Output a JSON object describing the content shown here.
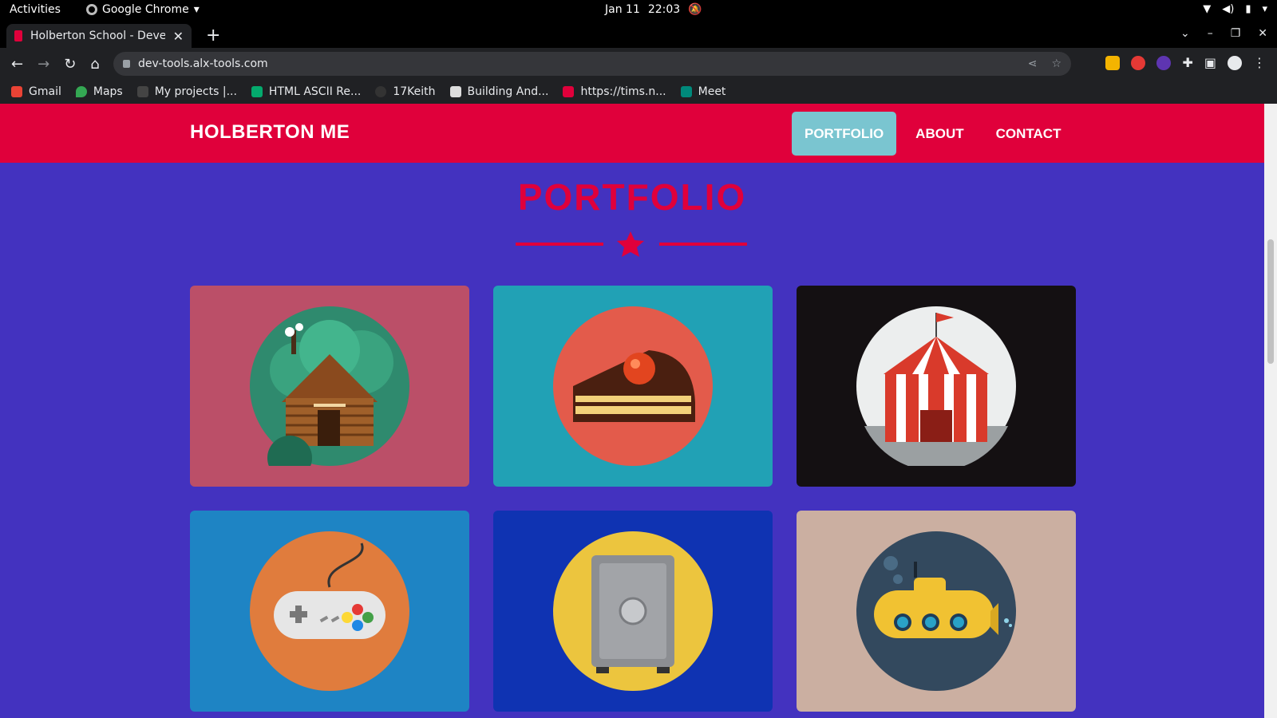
{
  "os_bar": {
    "activities": "Activities",
    "app_name": "Google Chrome",
    "date": "Jan 11",
    "time": "22:03"
  },
  "browser": {
    "tab_title": "Holberton School - Develo",
    "url": "dev-tools.alx-tools.com",
    "bookmarks": [
      {
        "label": "Gmail",
        "icon": "gmail-icon",
        "color": "#ea4335"
      },
      {
        "label": "Maps",
        "icon": "maps-icon",
        "color": "#34a853"
      },
      {
        "label": "My projects |...",
        "icon": "alx-icon",
        "color": "#444444"
      },
      {
        "label": "HTML ASCII Re...",
        "icon": "w3-icon",
        "color": "#04aa6d"
      },
      {
        "label": "17Keith",
        "icon": "github-icon",
        "color": "#333333"
      },
      {
        "label": "Building And...",
        "icon": "dac-icon",
        "color": "#dddddd"
      },
      {
        "label": "https://tims.n...",
        "icon": "tims-icon",
        "color": "#e0003b"
      },
      {
        "label": "Meet",
        "icon": "meet-icon",
        "color": "#00897b"
      }
    ]
  },
  "site": {
    "brand": "HOLBERTON ME",
    "nav": [
      {
        "label": "PORTFOLIO",
        "active": true
      },
      {
        "label": "ABOUT",
        "active": false
      },
      {
        "label": "CONTACT",
        "active": false
      }
    ],
    "section_title": "PORTFOLIO",
    "accent_color": "#e0003b",
    "background_color": "#4332bf",
    "portfolio": [
      {
        "icon": "log-cabin-icon",
        "background": "#bb4f68"
      },
      {
        "icon": "cake-slice-icon",
        "background": "#21a1b5"
      },
      {
        "icon": "circus-tent-icon",
        "background": "#141012"
      },
      {
        "icon": "game-controller-icon",
        "background": "#1e84c4"
      },
      {
        "icon": "safe-icon",
        "background": "#0f33b2"
      },
      {
        "icon": "submarine-icon",
        "background": "#cbafa1"
      }
    ]
  }
}
